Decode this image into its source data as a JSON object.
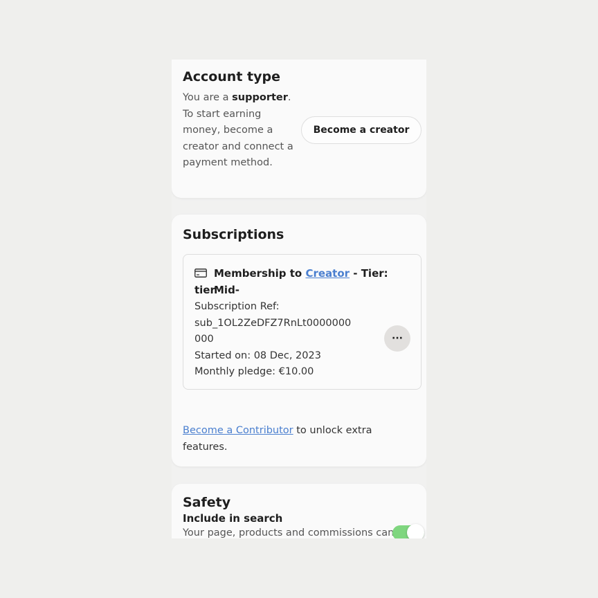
{
  "account": {
    "title": "Account type",
    "desc_prefix": "You are a ",
    "role": "supporter",
    "desc_suffix": ". To start earning money, become a creator and connect a payment method.",
    "become_creator_label": "Become a creator"
  },
  "subscriptions": {
    "title": "Subscriptions",
    "item": {
      "icon": "credit-card-icon",
      "heading_prefix": "Membership to ",
      "creator_link": "Creator",
      "heading_suffix": " - Tier: Mid-",
      "heading_line2": "tier",
      "ref_label": "Subscription Ref:",
      "ref_line1": "sub_1OL2ZeDFZ7RnLt0000000",
      "ref_line2": "000",
      "started": "Started on: 08 Dec, 2023",
      "pledge": "Monthly pledge: €10.00",
      "more_label": "···"
    },
    "contributor_link": "Become a Contributor",
    "contributor_suffix": " to unlock extra features."
  },
  "safety": {
    "title": "Safety",
    "include_label": "Include in search",
    "include_desc": "Your page, products and commissions can",
    "include_enabled": true
  },
  "colors": {
    "link": "#4a7fcf",
    "toggle_on": "#7fd67f",
    "background": "#efefed"
  }
}
